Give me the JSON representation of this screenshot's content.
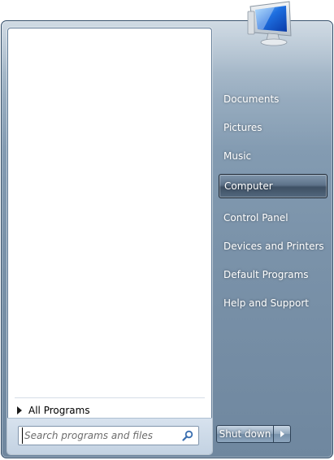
{
  "left_pane": {
    "all_programs_label": "All Programs"
  },
  "search": {
    "placeholder": "Search programs and files",
    "icon": "search-icon"
  },
  "user_picture": {
    "icon": "computer-monitor-icon"
  },
  "right_pane": {
    "items": [
      {
        "label": "Documents"
      },
      {
        "label": "Pictures"
      },
      {
        "label": "Music"
      },
      {
        "label": "Computer",
        "selected": true
      },
      {
        "label": "Control Panel"
      },
      {
        "label": "Devices and Printers"
      },
      {
        "label": "Default Programs"
      },
      {
        "label": "Help and Support"
      }
    ]
  },
  "shutdown": {
    "label": "Shut down",
    "arrow_icon": "chevron-right-icon"
  },
  "colors": {
    "frame_glass": "#7b93aa",
    "selection": "#3e5064",
    "text_light": "#ffffff"
  }
}
